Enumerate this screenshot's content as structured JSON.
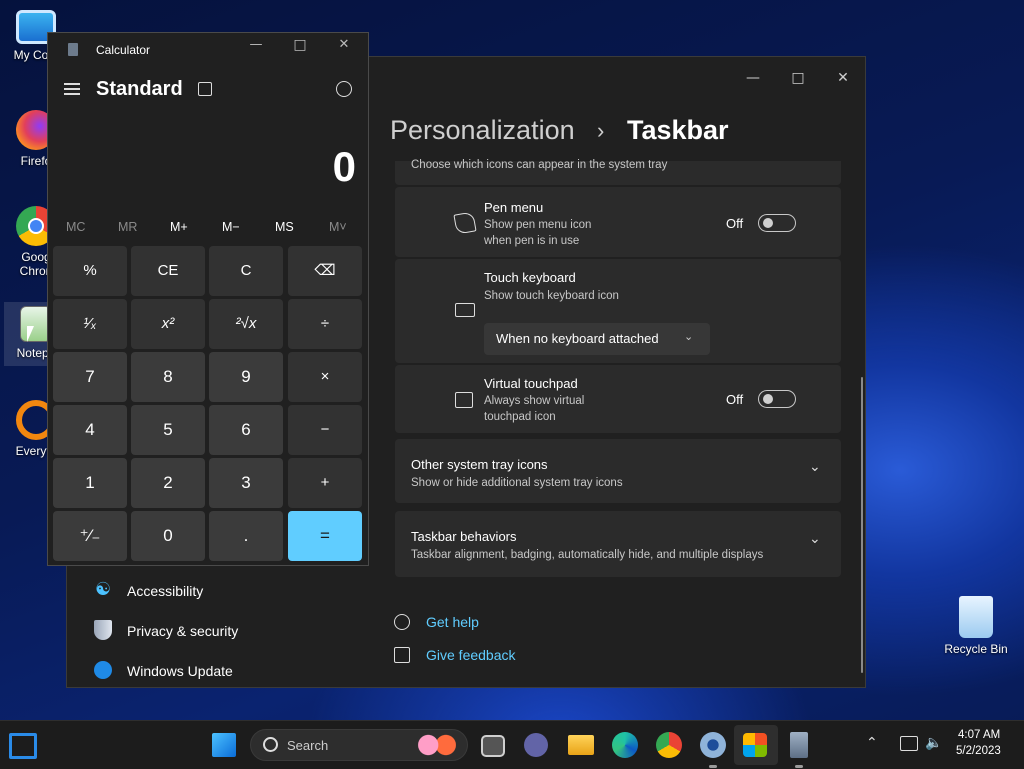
{
  "desktop": {
    "icons": [
      {
        "label": "My Com"
      },
      {
        "label": "Firefo"
      },
      {
        "label": "Goog Chron"
      },
      {
        "label": "Notepa"
      },
      {
        "label": "Everyth"
      },
      {
        "label": "Recycle Bin"
      }
    ]
  },
  "settings": {
    "breadcrumb_parent": "Personalization",
    "breadcrumb_sep": "›",
    "breadcrumb_current": "Taskbar",
    "top_text": "Choose which icons can appear in the system tray",
    "pen_menu": {
      "title": "Pen menu",
      "desc1": "Show pen menu icon",
      "desc2": "when pen is in use",
      "state": "Off"
    },
    "touch_keyboard": {
      "title": "Touch keyboard",
      "desc": "Show touch keyboard icon",
      "dropdown_value": "When no keyboard attached"
    },
    "virtual_touchpad": {
      "title": "Virtual touchpad",
      "desc1": "Always show virtual",
      "desc2": "touchpad icon",
      "state": "Off"
    },
    "other_tray": {
      "title": "Other system tray icons",
      "desc": "Show or hide additional system tray icons"
    },
    "behaviors": {
      "title": "Taskbar behaviors",
      "desc": "Taskbar alignment, badging, automatically hide, and multiple displays"
    },
    "get_help": "Get help",
    "give_feedback": "Give feedback",
    "nav": [
      {
        "label": "Accessibility"
      },
      {
        "label": "Privacy & security"
      },
      {
        "label": "Windows Update"
      }
    ]
  },
  "calculator": {
    "title": "Calculator",
    "mode": "Standard",
    "display": "0",
    "memory": [
      "MC",
      "MR",
      "M+",
      "M−",
      "MS",
      "M˅"
    ],
    "keys": [
      [
        "%",
        "CE",
        "C",
        "⌫"
      ],
      [
        "¹⁄ₓ",
        "x²",
        "²√x",
        "÷"
      ],
      [
        "7",
        "8",
        "9",
        "×"
      ],
      [
        "4",
        "5",
        "6",
        "−"
      ],
      [
        "1",
        "2",
        "3",
        "+"
      ],
      [
        "⁺⁄₋",
        "0",
        ".",
        "="
      ]
    ]
  },
  "taskbar": {
    "search_placeholder": "Search",
    "time": "4:07 AM",
    "date": "5/2/2023"
  },
  "colors": {
    "accent": "#60cdff",
    "window_bg": "#202020",
    "card_bg": "#2b2b2b",
    "taskbar_bg": "#1c1c1c"
  }
}
